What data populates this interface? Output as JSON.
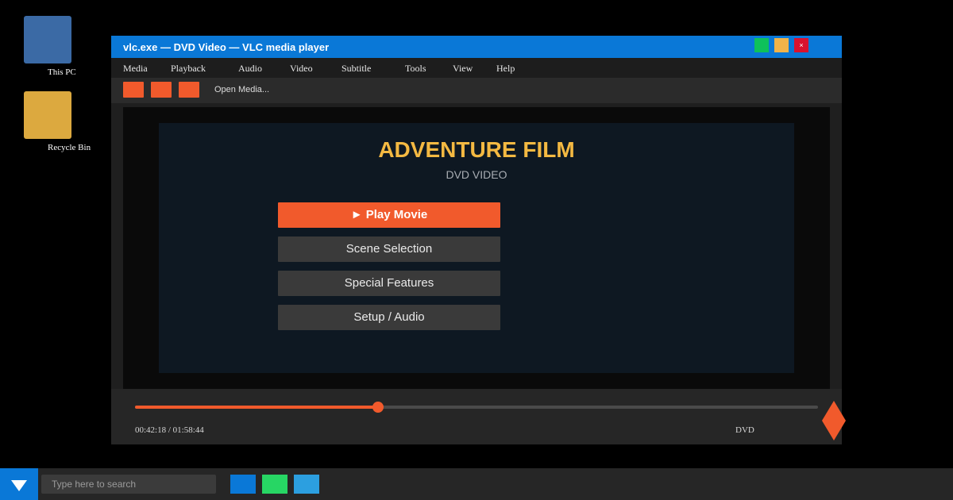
{
  "desktop": {
    "icons": [
      {
        "label": "This PC"
      },
      {
        "label": "Recycle Bin"
      }
    ]
  },
  "window": {
    "title": "vlc.exe — DVD Video — VLC media player",
    "close_glyph": "×",
    "menu": [
      "Media",
      "Playback",
      "Audio",
      "Video",
      "Subtitle",
      "Tools",
      "View",
      "Help"
    ],
    "toolbar": {
      "open_media_label": "Open Media..."
    }
  },
  "dvd_menu": {
    "title": "ADVENTURE FILM",
    "subtitle": "DVD VIDEO",
    "buttons": [
      {
        "label": "► Play Movie",
        "selected": true
      },
      {
        "label": "Scene Selection",
        "selected": false
      },
      {
        "label": "Special Features",
        "selected": false
      },
      {
        "label": "Setup / Audio",
        "selected": false
      }
    ]
  },
  "playback": {
    "time_display": "00:42:18 / 01:58:44",
    "elapsed_seconds": 2538,
    "duration_seconds": 7124,
    "source": "DVD"
  },
  "taskbar": {
    "search_placeholder": "Type here to search",
    "apps": [
      "edge-icon",
      "messaging-icon",
      "store-icon"
    ]
  },
  "colors": {
    "accent": "#f15a2c",
    "titlebar": "#0a78d7",
    "dvd_title": "#f4b942"
  }
}
